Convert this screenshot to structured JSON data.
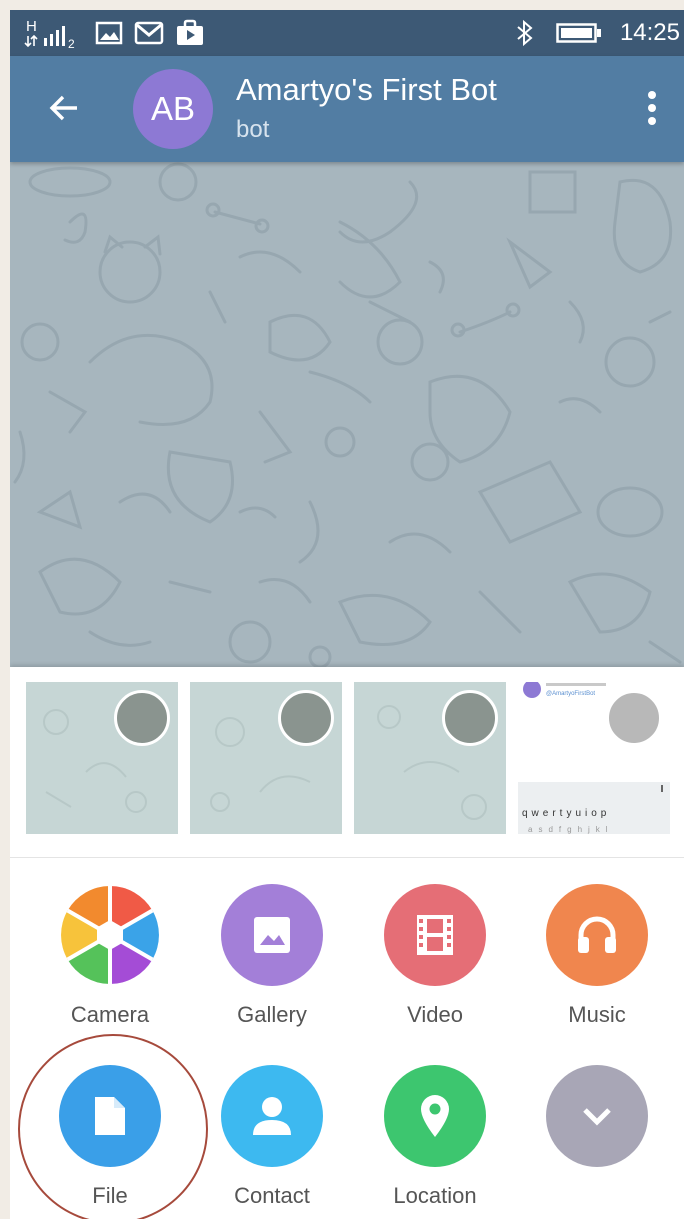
{
  "status_bar": {
    "network_label": "H",
    "time": "14:25",
    "icons": [
      "network-signal-icon",
      "image-notification-icon",
      "gmail-icon",
      "shop-icon",
      "bluetooth-icon",
      "battery-icon"
    ]
  },
  "toolbar": {
    "avatar_initials": "AB",
    "title": "Amartyo's First Bot",
    "subtitle": "bot",
    "back_icon": "arrow-back-icon",
    "menu_icon": "more-vert-icon"
  },
  "photo_strip": {
    "preview_handle": "@AmartyoFirstBot",
    "keyboard_row": [
      "q",
      "w",
      "e",
      "r",
      "t",
      "y",
      "u",
      "i",
      "o",
      "p"
    ]
  },
  "attach_actions": [
    {
      "label": "Camera",
      "icon": "camera-aperture-icon",
      "color": "multicolor"
    },
    {
      "label": "Gallery",
      "icon": "image-icon",
      "color": "#a37fd8"
    },
    {
      "label": "Video",
      "icon": "film-icon",
      "color": "#e56e76"
    },
    {
      "label": "Music",
      "icon": "headphones-icon",
      "color": "#f0864e"
    },
    {
      "label": "File",
      "icon": "file-icon",
      "color": "#3a9fe8"
    },
    {
      "label": "Contact",
      "icon": "person-icon",
      "color": "#3db9f0"
    },
    {
      "label": "Location",
      "icon": "location-pin-icon",
      "color": "#3dc66f"
    },
    {
      "label": "",
      "icon": "chevron-down-icon",
      "color": "#a8a6b6"
    }
  ],
  "colors": {
    "status_bar": "#3d5975",
    "toolbar": "#527da3",
    "avatar": "#8d79d4",
    "chat_background": "#a7b6be",
    "highlight_ring": "#a64a3c"
  }
}
